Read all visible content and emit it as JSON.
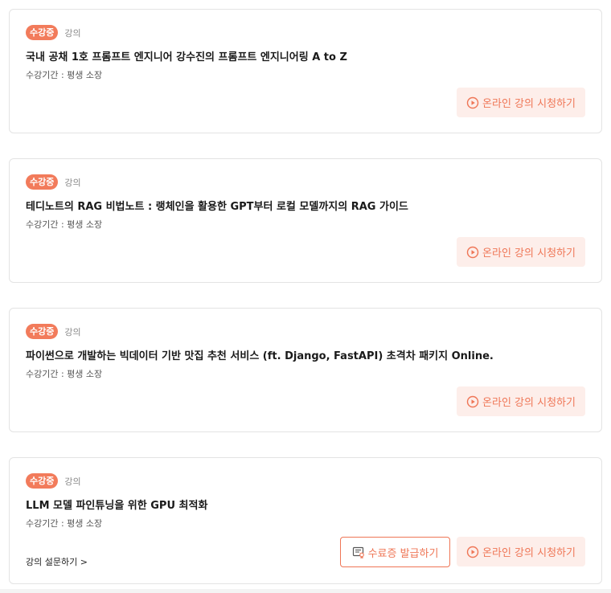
{
  "courses": [
    {
      "badge": "수강중",
      "type": "강의",
      "title": "국내 공채 1호 프롬프트 엔지니어 강수진의 프롬프트 엔지니어링 A to Z",
      "period": "수강기간 : 평생 소장",
      "watch_label": "온라인 강의 시청하기"
    },
    {
      "badge": "수강중",
      "type": "강의",
      "title": "테디노트의 RAG 비법노트 : 랭체인을 활용한 GPT부터 로컬 모델까지의 RAG 가이드",
      "period": "수강기간 : 평생 소장",
      "watch_label": "온라인 강의 시청하기"
    },
    {
      "badge": "수강중",
      "type": "강의",
      "title": "파이썬으로 개발하는 빅데이터 기반 맛집 추천 서비스 (ft. Django, FastAPI) 초격차 패키지 Online.",
      "period": "수강기간 : 평생 소장",
      "watch_label": "온라인 강의 시청하기"
    },
    {
      "badge": "수강중",
      "type": "강의",
      "title": "LLM 모델 파인튜닝을 위한 GPU 최적화",
      "period": "수강기간 : 평생 소장",
      "watch_label": "온라인 강의 시청하기",
      "certificate_label": "수료증 발급하기",
      "survey_label": "강의 설문하기 >"
    }
  ],
  "colors": {
    "accent": "#ef7656",
    "badge_bg": "#f27b5b",
    "watch_btn_bg": "#fdeeea",
    "border": "#e3e3e3"
  },
  "icons": {
    "watch": "play-circle-icon",
    "certificate": "certificate-icon"
  }
}
